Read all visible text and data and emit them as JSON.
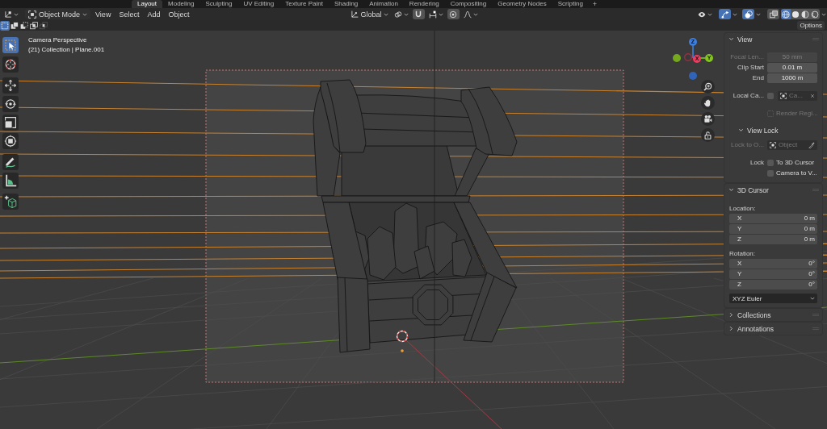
{
  "workspace_tabs": [
    {
      "label": "Layout",
      "selected": true
    },
    {
      "label": "Modeling",
      "selected": false
    },
    {
      "label": "Sculpting",
      "selected": false
    },
    {
      "label": "UV Editing",
      "selected": false
    },
    {
      "label": "Texture Paint",
      "selected": false
    },
    {
      "label": "Shading",
      "selected": false
    },
    {
      "label": "Animation",
      "selected": false
    },
    {
      "label": "Rendering",
      "selected": false
    },
    {
      "label": "Compositing",
      "selected": false
    },
    {
      "label": "Geometry Nodes",
      "selected": false
    },
    {
      "label": "Scripting",
      "selected": false
    }
  ],
  "add_workspace": "+",
  "header": {
    "mode": "Object Mode",
    "menus": [
      "View",
      "Select",
      "Add",
      "Object"
    ],
    "orientation": "Global",
    "snap": {
      "on": false
    },
    "proportional_editing": {
      "on": false
    },
    "gizmos": {
      "on": true
    },
    "overlays": {
      "on": true
    },
    "xray": {
      "on": false
    },
    "shading": [
      {
        "kind": "wireframe",
        "selected": true
      },
      {
        "kind": "solid",
        "selected": false
      },
      {
        "kind": "material",
        "selected": false
      },
      {
        "kind": "rendered",
        "selected": false
      }
    ]
  },
  "tool_settings": {
    "selection_modes": [
      {
        "kind": "set",
        "selected": true
      },
      {
        "kind": "extend",
        "selected": false
      },
      {
        "kind": "subtract",
        "selected": false
      },
      {
        "kind": "invert",
        "selected": false
      },
      {
        "kind": "intersect",
        "selected": false
      }
    ],
    "options": "Options"
  },
  "toolbar": {
    "tools": [
      {
        "kind": "select-box",
        "selected": true
      },
      {
        "kind": "cursor",
        "selected": false
      },
      {
        "kind": "move",
        "selected": false
      },
      {
        "kind": "rotate",
        "selected": false
      },
      {
        "kind": "scale",
        "selected": false
      },
      {
        "kind": "transform",
        "selected": false
      },
      {
        "kind": "annotate",
        "selected": false
      },
      {
        "kind": "measure",
        "selected": false
      },
      {
        "kind": "add-cube",
        "selected": false
      }
    ]
  },
  "viewport": {
    "info": [
      "Camera Perspective",
      "(21) Collection | Plane.001"
    ]
  },
  "navigation_gizmo": {
    "axes": [
      {
        "kind": "labeled",
        "label": "Z",
        "color": "#3d7fe0"
      },
      {
        "kind": "labeled",
        "label": "X",
        "color": "#ee3b5f"
      },
      {
        "kind": "labeled",
        "label": "Y",
        "color": "#84c41e"
      },
      {
        "kind": "ring",
        "color": "#9b2e44"
      },
      {
        "kind": "filled",
        "color": "#76a81d"
      },
      {
        "kind": "filled",
        "color": "#2f64b8"
      }
    ]
  },
  "sidebar": {
    "panels": [
      {
        "title": "View",
        "expanded": true,
        "rows": [
          {
            "kind": "number",
            "label": "Focal Len...",
            "value": "50 mm",
            "disabled": true
          },
          {
            "kind": "number",
            "label": "Clip Start",
            "value": "0.01 m",
            "disabled": false
          },
          {
            "kind": "number",
            "label": "End",
            "value": "1000 m",
            "disabled": false
          },
          {
            "kind": "camera",
            "label": "Local Ca...",
            "checked": false,
            "value": "Ca...",
            "disabled": false
          },
          {
            "kind": "checkbox",
            "text": "Render Regi...",
            "checked": false,
            "disabled": true
          }
        ],
        "subpanels": [
          {
            "title": "View Lock",
            "expanded": true,
            "rows": [
              {
                "kind": "object",
                "label": "Lock to O...",
                "placeholder": "Object",
                "disabled": true
              },
              {
                "kind": "checkbox",
                "label": "Lock",
                "text": "To 3D Cursor",
                "checked": false,
                "disabled": false
              },
              {
                "kind": "checkbox",
                "text": "Camera to V...",
                "checked": false,
                "disabled": false
              }
            ]
          }
        ]
      },
      {
        "title": "3D Cursor",
        "expanded": true,
        "rows": [
          {
            "kind": "heading",
            "text": "Location:"
          },
          {
            "kind": "vector",
            "items": [
              {
                "axis": "X",
                "value": "0 m"
              },
              {
                "axis": "Y",
                "value": "0 m"
              },
              {
                "axis": "Z",
                "value": "0 m"
              }
            ]
          },
          {
            "kind": "heading",
            "text": "Rotation:"
          },
          {
            "kind": "vector",
            "items": [
              {
                "axis": "X",
                "value": "0°"
              },
              {
                "axis": "Y",
                "value": "0°"
              },
              {
                "axis": "Z",
                "value": "0°"
              }
            ]
          },
          {
            "kind": "dropdown",
            "value": "XYZ Euler"
          }
        ]
      },
      {
        "title": "Collections",
        "expanded": false
      },
      {
        "title": "Annotations",
        "expanded": false
      }
    ]
  }
}
